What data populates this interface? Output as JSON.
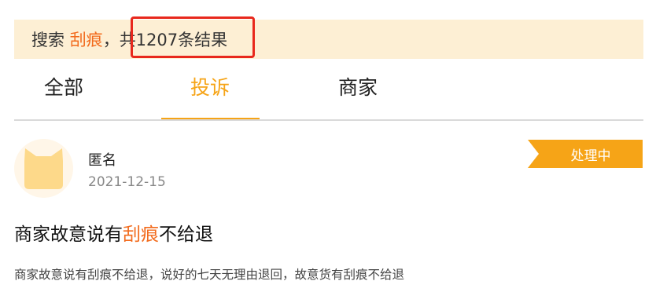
{
  "search": {
    "prefix": "搜索",
    "keyword": "刮痕",
    "separator": "，",
    "count_text": "共1207条结果"
  },
  "tabs": [
    {
      "label": "全部",
      "active": false
    },
    {
      "label": "投诉",
      "active": true
    },
    {
      "label": "商家",
      "active": false
    }
  ],
  "post": {
    "user": "匿名",
    "date": "2021-12-15",
    "status": "处理中",
    "title_before": "商家故意说有",
    "title_keyword": "刮痕",
    "title_after": "不给退",
    "excerpt": "商家故意说有刮痕不给退，说好的七天无理由退回，故意货有刮痕不给退"
  },
  "colors": {
    "accent": "#f6a417",
    "keyword": "#f26b1d",
    "banner_bg": "#fdefd4",
    "highlight_box": "#e8281c",
    "avatar": "#fdd98a"
  },
  "icons": {
    "avatar": "cat-avatar-icon"
  }
}
